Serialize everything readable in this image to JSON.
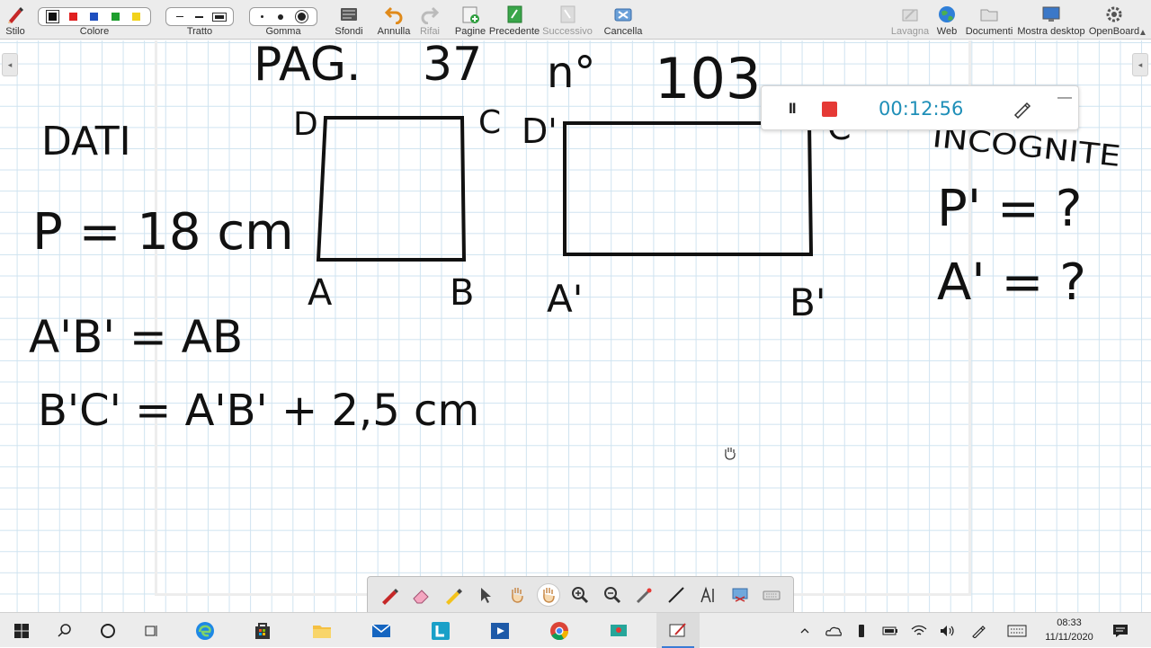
{
  "toolbar": {
    "stilo": "Stilo",
    "colore": "Colore",
    "tratto": "Tratto",
    "gomma": "Gomma",
    "sfondi": "Sfondi",
    "annulla": "Annulla",
    "rifai": "Rifai",
    "pagine": "Pagine",
    "precedente": "Precedente",
    "successivo": "Successivo",
    "cancella": "Cancella",
    "lavagna": "Lavagna",
    "web": "Web",
    "documenti": "Documenti",
    "mostra_desktop": "Mostra desktop",
    "openboard": "OpenBoard",
    "colors": [
      "#111111",
      "#e02020",
      "#1f4fbf",
      "#1e9e2e",
      "#f2d21b"
    ]
  },
  "board": {
    "header": "PAG. 37   n° 103",
    "header_page": "PAG.",
    "header_page_num": "37",
    "header_n": "n°",
    "header_num": "103",
    "dati_title": "DATI",
    "line_p": "P = 18 cm",
    "line_ab": "A'B' = AB",
    "line_bc": "B'C' = A'B' + 2,5 cm",
    "square_labels": {
      "d": "D",
      "c": "C",
      "a": "A",
      "b": "B"
    },
    "rect_labels": {
      "d": "D'",
      "c": "C'",
      "a": "A'",
      "b": "B'"
    },
    "incognite_title": "INCOGNITE",
    "line_p2": "P' = ?",
    "line_a2": "A' = ?"
  },
  "recorder": {
    "time": "00:12:56",
    "pause_label": "II"
  },
  "palette": {
    "tools": [
      "pen-icon",
      "eraser-icon",
      "highlighter-icon",
      "pointer-icon",
      "play-hand-icon",
      "hand-icon",
      "zoom-in-icon",
      "zoom-out-icon",
      "laser-pointer-icon",
      "line-icon",
      "text-icon",
      "capture-icon",
      "keyboard-icon"
    ],
    "selected": "hand-icon"
  },
  "taskbar": {
    "time": "08:33",
    "date": "11/11/2020"
  }
}
